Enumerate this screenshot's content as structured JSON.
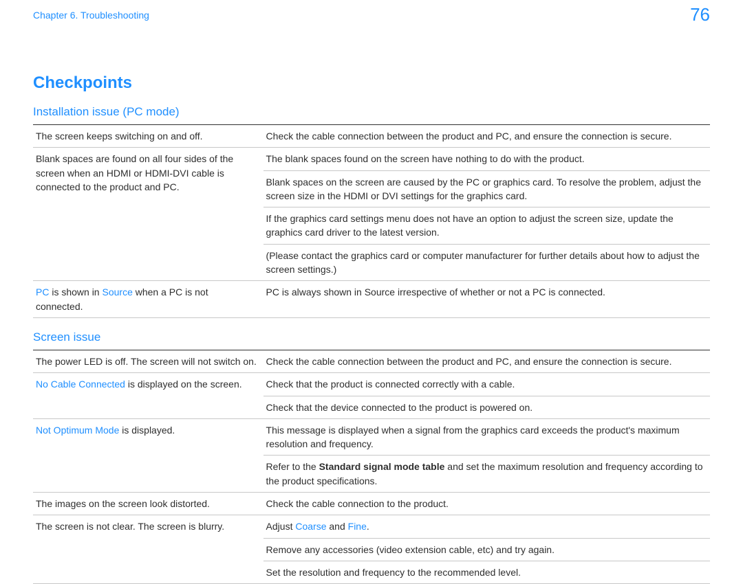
{
  "header": {
    "chapter": "Chapter 6. Troubleshooting",
    "page": "76"
  },
  "title": "Checkpoints",
  "sections": [
    {
      "heading": "Installation issue (PC mode)",
      "rows": [
        {
          "left": [
            {
              "t": "The screen keeps switching on and off."
            }
          ],
          "right": [
            [
              {
                "t": "Check the cable connection between the product and PC, and ensure the connection is secure."
              }
            ]
          ]
        },
        {
          "left": [
            {
              "t": "Blank spaces are found on all four sides of the screen when an HDMI or HDMI-DVI cable is connected to the product and PC."
            }
          ],
          "right": [
            [
              {
                "t": "The blank spaces found on the screen have nothing to do with the product."
              }
            ],
            [
              {
                "t": "Blank spaces on the screen are caused by the PC or graphics card. To resolve the problem, adjust the screen size in the HDMI or DVI settings for the graphics card."
              }
            ],
            [
              {
                "t": "If the graphics card settings menu does not have an option to adjust the screen size, update the graphics card driver to the latest version."
              }
            ],
            [
              {
                "t": "(Please contact the graphics card or computer manufacturer for further details about how to adjust the screen settings.)"
              }
            ]
          ]
        },
        {
          "left": [
            {
              "t": "PC",
              "c": "blue"
            },
            {
              "t": " is shown in "
            },
            {
              "t": "Source",
              "c": "blue"
            },
            {
              "t": " when a PC is not connected."
            }
          ],
          "right": [
            [
              {
                "t": "PC is always shown in Source irrespective of whether or not a PC is connected."
              }
            ]
          ]
        }
      ]
    },
    {
      "heading": "Screen issue",
      "rows": [
        {
          "left": [
            {
              "t": "The power LED is off. The screen will not switch on."
            }
          ],
          "right": [
            [
              {
                "t": "Check the cable connection between the product and PC, and ensure the connection is secure."
              }
            ]
          ]
        },
        {
          "left": [
            {
              "t": "No Cable Connected",
              "c": "blue"
            },
            {
              "t": " is displayed on the screen."
            }
          ],
          "right": [
            [
              {
                "t": "Check that the product is connected correctly with a cable."
              }
            ],
            [
              {
                "t": "Check that the device connected to the product is powered on."
              }
            ]
          ]
        },
        {
          "left": [
            {
              "t": "Not Optimum Mode",
              "c": "blue"
            },
            {
              "t": " is displayed."
            }
          ],
          "right": [
            [
              {
                "t": "This message is displayed when a signal from the graphics card exceeds the product's maximum resolution and frequency."
              }
            ],
            [
              {
                "t": "Refer to the "
              },
              {
                "t": "Standard signal mode table",
                "c": "bold"
              },
              {
                "t": " and set the maximum resolution and frequency according to the product specifications."
              }
            ]
          ]
        },
        {
          "left": [
            {
              "t": "The images on the screen look distorted."
            }
          ],
          "right": [
            [
              {
                "t": "Check the cable connection to the product."
              }
            ]
          ]
        },
        {
          "left": [
            {
              "t": "The screen is not clear. The screen is blurry."
            }
          ],
          "right": [
            [
              {
                "t": "Adjust "
              },
              {
                "t": "Coarse",
                "c": "blue"
              },
              {
                "t": " and "
              },
              {
                "t": "Fine",
                "c": "blue"
              },
              {
                "t": "."
              }
            ],
            [
              {
                "t": "Remove any accessories (video extension cable, etc) and try again."
              }
            ],
            [
              {
                "t": "Set the resolution and frequency to the recommended level."
              }
            ]
          ]
        }
      ]
    }
  ]
}
